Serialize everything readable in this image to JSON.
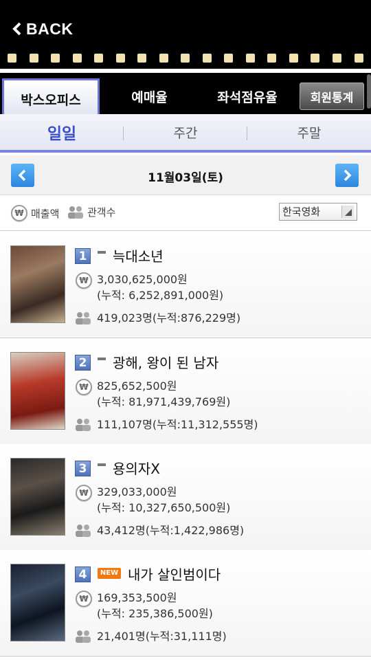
{
  "header": {
    "back_label": "BACK"
  },
  "tabs": [
    {
      "label": "박스오피스",
      "active": true
    },
    {
      "label": "예매율",
      "active": false
    },
    {
      "label": "좌석점유율",
      "active": false
    },
    {
      "label": "회원통계",
      "active": false
    }
  ],
  "period_tabs": [
    {
      "label": "일일",
      "active": true
    },
    {
      "label": "주간",
      "active": false
    },
    {
      "label": "주말",
      "active": false
    }
  ],
  "date_nav": {
    "date": "11월03일(토)"
  },
  "filter": {
    "sales_legend": "매출액",
    "audience_legend": "관객수",
    "won_symbol": "₩",
    "select_value": "한국영화"
  },
  "movies": [
    {
      "rank": "1",
      "change": "dash",
      "title": "늑대소년",
      "sales": "3,030,625,000원",
      "sales_cumulative": "(누적: 6,252,891,000원)",
      "audience": "419,023명(누적:876,229명)"
    },
    {
      "rank": "2",
      "change": "dash",
      "title": "광해, 왕이 된 남자",
      "sales": "825,652,500원",
      "sales_cumulative": "(누적: 81,971,439,769원)",
      "audience": "111,107명(누적:11,312,555명)"
    },
    {
      "rank": "3",
      "change": "dash",
      "title": "용의자X",
      "sales": "329,033,000원",
      "sales_cumulative": "(누적: 10,327,650,500원)",
      "audience": "43,412명(누적:1,422,986명)"
    },
    {
      "rank": "4",
      "change": "new",
      "new_badge": "NEW",
      "title": "내가 살인범이다",
      "sales": "169,353,500원",
      "sales_cumulative": "(누적: 235,386,500원)",
      "audience": "21,401명(누적:31,111명)"
    }
  ],
  "colors": {
    "accent": "#3b4fc8",
    "header_bg": "#000000",
    "new_badge": "#f07a12",
    "arrow_button": "#2c86dd"
  }
}
